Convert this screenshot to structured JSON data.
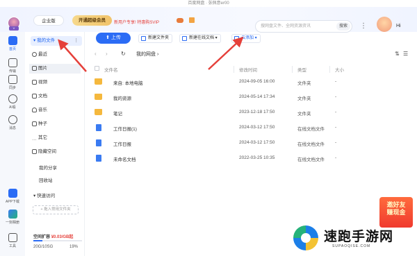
{
  "window": {
    "title": "百度网盘 · 张佩意er00"
  },
  "header": {
    "enterprise": "企业版",
    "vip": "开通超级会员",
    "promo": "新用户专享! 特惠购SVIP",
    "search_placeholder": "搜网盘文件、全网资源资讯",
    "search_btn": "搜索",
    "user_greeting": "Hi"
  },
  "rail": [
    {
      "label": "首页"
    },
    {
      "label": "传输"
    },
    {
      "label": "同步"
    },
    {
      "label": "AI看"
    },
    {
      "label": "消息"
    },
    {
      "label": "APP下载"
    },
    {
      "label": "一刻相册"
    },
    {
      "label": "工具"
    }
  ],
  "sidebar": {
    "my_files": "我的文件",
    "items": [
      {
        "label": "最近"
      },
      {
        "label": "图片"
      },
      {
        "label": "视频"
      },
      {
        "label": "文档"
      },
      {
        "label": "音乐"
      },
      {
        "label": "种子"
      },
      {
        "label": "其它"
      },
      {
        "label": "隐藏空间"
      }
    ],
    "share": "我的分享",
    "recycle": "回收站",
    "quick_access": "快速访问",
    "quick_add": "+ 拖入常用文件夹",
    "space_title": "空间扩容",
    "space_promo": "¥0.03/GB起",
    "space_used": "20G/10SG",
    "space_pct": "19%",
    "space_fraction": 0.19
  },
  "toolbar": {
    "upload": "上传",
    "new_folder": "新建文件夹",
    "new_online_doc": "新建在线文档",
    "cloud_add": "云添加"
  },
  "breadcrumb": {
    "path": "我的网盘"
  },
  "table": {
    "columns": [
      "文件名",
      "修改时间",
      "类型",
      "大小"
    ],
    "rows": [
      {
        "icon": "folder",
        "name": "来自: 本地电脑",
        "time": "2024-09-05 16:00",
        "type": "文件夹",
        "size": "-"
      },
      {
        "icon": "folder",
        "name": "我的资源",
        "time": "2024-05-14 17:34",
        "type": "文件夹",
        "size": "-"
      },
      {
        "icon": "folder",
        "name": "笔记",
        "time": "2023-12-18 17:50",
        "type": "文件夹",
        "size": "-"
      },
      {
        "icon": "doc",
        "name": "工作日报(1)",
        "time": "2024-03-12 17:50",
        "type": "在线文档文件",
        "size": "-"
      },
      {
        "icon": "doc",
        "name": "工作日报",
        "time": "2024-03-12 17:50",
        "type": "在线文档文件",
        "size": "-"
      },
      {
        "icon": "doc",
        "name": "未命名文档",
        "time": "2022-03-25 10:35",
        "type": "在线文档文件",
        "size": "-"
      }
    ]
  },
  "ad": {
    "line1": "邀好友",
    "line2": "赚现金"
  },
  "watermark": {
    "title": "速跑手游网",
    "subtitle": "SUPAOQISE.COM"
  },
  "colors": {
    "accent": "#2b6cf5",
    "arrow": "#e5403a",
    "folder": "#f5b83d",
    "doc": "#3a7bf2"
  }
}
